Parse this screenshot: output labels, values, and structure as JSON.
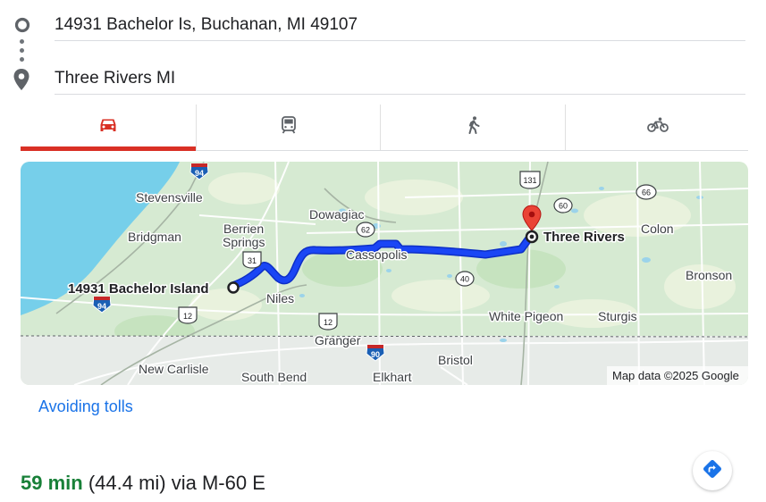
{
  "directions": {
    "origin": "14931 Bachelor Is, Buchanan, MI 49107",
    "destination": "Three Rivers MI"
  },
  "travel_modes": [
    {
      "name": "driving",
      "icon": "car-icon",
      "selected": true
    },
    {
      "name": "transit",
      "icon": "transit-icon",
      "selected": false
    },
    {
      "name": "walking",
      "icon": "walking-icon",
      "selected": false
    },
    {
      "name": "cycling",
      "icon": "bicycle-icon",
      "selected": false
    }
  ],
  "colors": {
    "accent_red": "#d93025",
    "route_blue": "#1a3fe0",
    "duration_green": "#188038",
    "link_blue": "#1a73e8"
  },
  "map": {
    "places": {
      "stevensville": "Stevensville",
      "bridgman": "Bridgman",
      "berrien": "Berrien",
      "springs": "Springs",
      "dowagiac": "Dowagiac",
      "cassopolis": "Cassopolis",
      "niles": "Niles",
      "colon": "Colon",
      "bronson": "Bronson",
      "white_pigeon": "White Pigeon",
      "sturgis": "Sturgis",
      "granger": "Granger",
      "bristol": "Bristol",
      "new_carlisle": "New Carlisle",
      "south_bend": "South Bend",
      "elkhart": "Elkhart"
    },
    "route_origin_label": "14931 Bachelor Island",
    "route_destination_label": "Three Rivers",
    "shields": {
      "i94_top": "94",
      "i94_bottom": "94",
      "us131": "131",
      "m66": "66",
      "m60": "60",
      "m62": "62",
      "us31": "31",
      "m40": "40",
      "us12_left": "12",
      "us12_mid": "12",
      "i90": "90"
    },
    "attribution": "Map data ©2025 Google"
  },
  "avoiding_tolls": "Avoiding tolls",
  "summary": {
    "duration": "59 min",
    "distance": "(44.4 mi)",
    "via": "via M-60 E"
  }
}
